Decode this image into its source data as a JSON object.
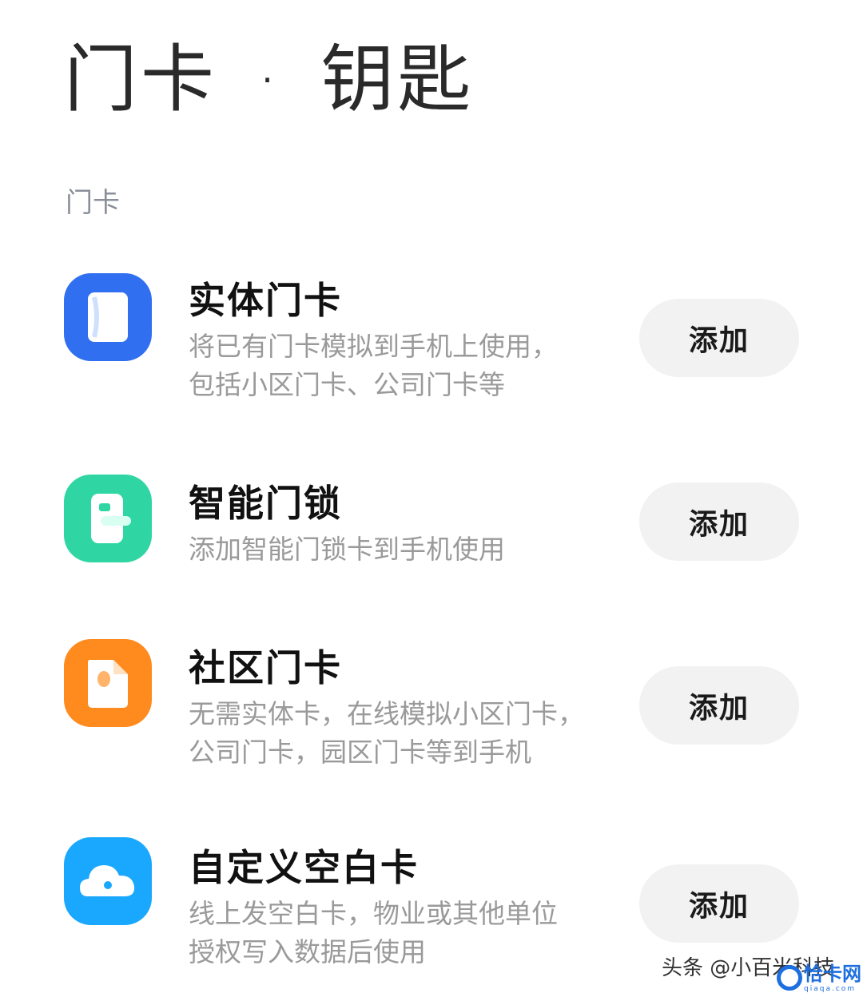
{
  "header": {
    "title_left": "门卡",
    "separator": "·",
    "title_right": "钥匙"
  },
  "section": {
    "label": "门卡"
  },
  "items": [
    {
      "title": "实体门卡",
      "desc_line1": "将已有门卡模拟到手机上使用，",
      "desc_line2": "包括小区门卡、公司门卡等",
      "button": "添加",
      "icon": "physical-card-icon",
      "color": "#2f6ff0"
    },
    {
      "title": "智能门锁",
      "desc_line1": "添加智能门锁卡到手机使用",
      "button": "添加",
      "icon": "smart-lock-icon",
      "color": "#2fd6a4"
    },
    {
      "title": "社区门卡",
      "desc_line1": "无需实体卡，在线模拟小区门卡，",
      "desc_line2": "公司门卡，园区门卡等到手机",
      "button": "添加",
      "icon": "community-card-icon",
      "color": "#ff8a1e"
    },
    {
      "title": "自定义空白卡",
      "desc_line1": "线上发空白卡，物业或其他单位",
      "desc_line2": "授权写入数据后使用",
      "button": "添加",
      "icon": "cloud-blank-card-icon",
      "color": "#1aa8ff"
    }
  ],
  "watermark": {
    "text": "头条 @小百米科技",
    "logo_text": "恰卡网",
    "logo_sub": "qiaqa.com"
  }
}
